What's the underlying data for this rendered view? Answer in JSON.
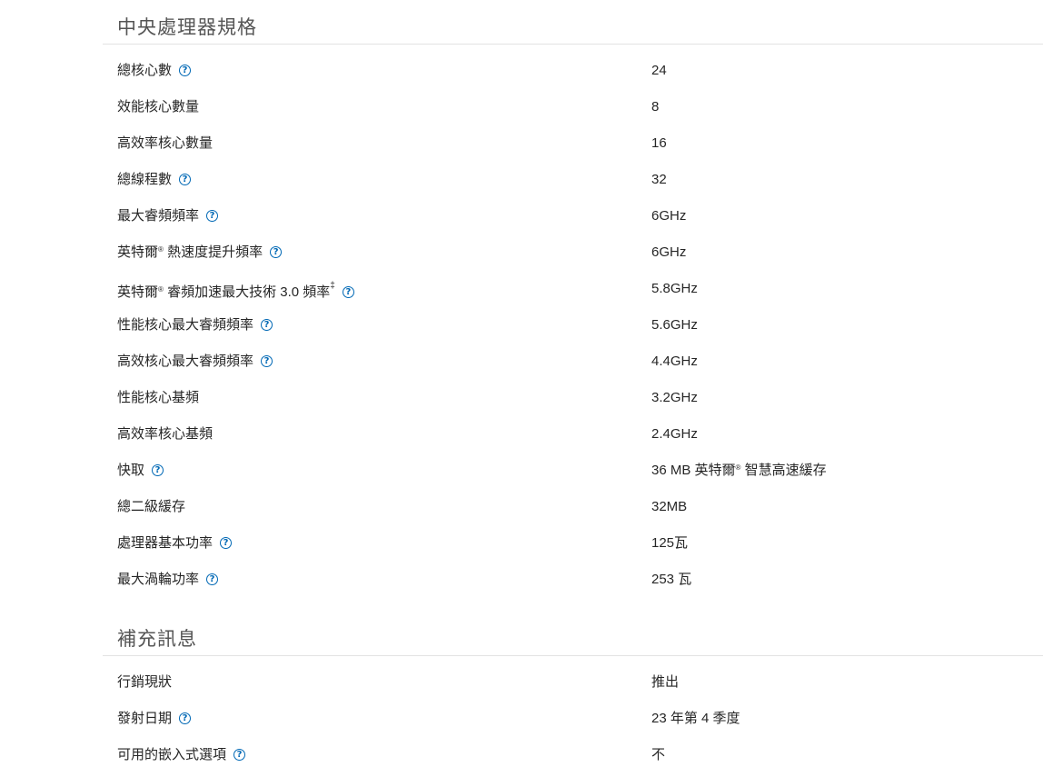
{
  "cpu_section": {
    "title": "中央處理器規格",
    "rows": [
      {
        "label": "總核心數",
        "value": "24",
        "help": true
      },
      {
        "label": "效能核心數量",
        "value": "8",
        "help": false
      },
      {
        "label": "高效率核心數量",
        "value": "16",
        "help": false
      },
      {
        "label": "總線程數",
        "value": "32",
        "help": true
      },
      {
        "label": "最大睿頻頻率",
        "value": "6GHz",
        "help": true
      },
      {
        "label_pre": "英特爾",
        "label_reg": "®",
        "label_post": " 熱速度提升頻率",
        "value": "6GHz",
        "help": true
      },
      {
        "label_pre": "英特爾",
        "label_reg": "®",
        "label_post": " 睿頻加速最大技術 3.0 頻率",
        "label_mark": "‡",
        "value": "5.8GHz",
        "help": true
      },
      {
        "label": "性能核心最大睿頻頻率",
        "value": "5.6GHz",
        "help": true
      },
      {
        "label": "高效核心最大睿頻頻率",
        "value": "4.4GHz",
        "help": true
      },
      {
        "label": "性能核心基頻",
        "value": "3.2GHz",
        "help": false
      },
      {
        "label": "高效率核心基頻",
        "value": "2.4GHz",
        "help": false
      },
      {
        "label": "快取",
        "value_pre": "36 MB 英特爾",
        "value_reg": "®",
        "value_post": " 智慧高速緩存",
        "help": true
      },
      {
        "label": "總二級緩存",
        "value": "32MB",
        "help": false
      },
      {
        "label": "處理器基本功率",
        "value": "125瓦",
        "help": true
      },
      {
        "label": "最大渦輪功率",
        "value": "253 瓦",
        "help": true
      }
    ]
  },
  "supplemental_section": {
    "title": "補充訊息",
    "rows": [
      {
        "label": "行銷現狀",
        "value": "推出",
        "help": false
      },
      {
        "label": "發射日期",
        "value": "23 年第 4 季度",
        "help": true
      },
      {
        "label": "可用的嵌入式選項",
        "value": "不",
        "help": true
      }
    ]
  },
  "help_icon_glyph": "?",
  "colors": {
    "accent": "#0068b5",
    "text": "#262626",
    "rule": "#e3e3e3"
  }
}
